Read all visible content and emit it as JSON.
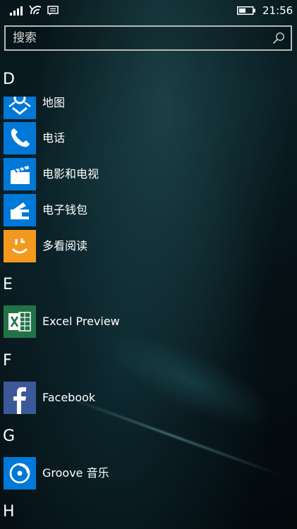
{
  "status_bar": {
    "time": "21:56",
    "icons": [
      "signal-icon",
      "wifi-icon",
      "message-icon",
      "battery-icon"
    ]
  },
  "search": {
    "placeholder": "搜索",
    "icon": "search-icon"
  },
  "sections": [
    {
      "letter": "D",
      "apps": [
        {
          "name": "地图",
          "icon": "maps-icon",
          "color": "#0078d7"
        },
        {
          "name": "电话",
          "icon": "phone-icon",
          "color": "#0078d7"
        },
        {
          "name": "电影和电视",
          "icon": "movies-tv-icon",
          "color": "#0078d7"
        },
        {
          "name": "电子钱包",
          "icon": "wallet-icon",
          "color": "#0078d7"
        },
        {
          "name": "多看阅读",
          "icon": "duokan-icon",
          "color": "#f39a1e"
        }
      ]
    },
    {
      "letter": "E",
      "apps": [
        {
          "name": "Excel Preview",
          "icon": "excel-icon",
          "color": "#217346"
        }
      ]
    },
    {
      "letter": "F",
      "apps": [
        {
          "name": "Facebook",
          "icon": "facebook-icon",
          "color": "#3b5998"
        }
      ]
    },
    {
      "letter": "G",
      "apps": [
        {
          "name": "Groove 音乐",
          "icon": "groove-music-icon",
          "color": "#0078d7"
        }
      ]
    },
    {
      "letter": "H",
      "apps": []
    }
  ]
}
